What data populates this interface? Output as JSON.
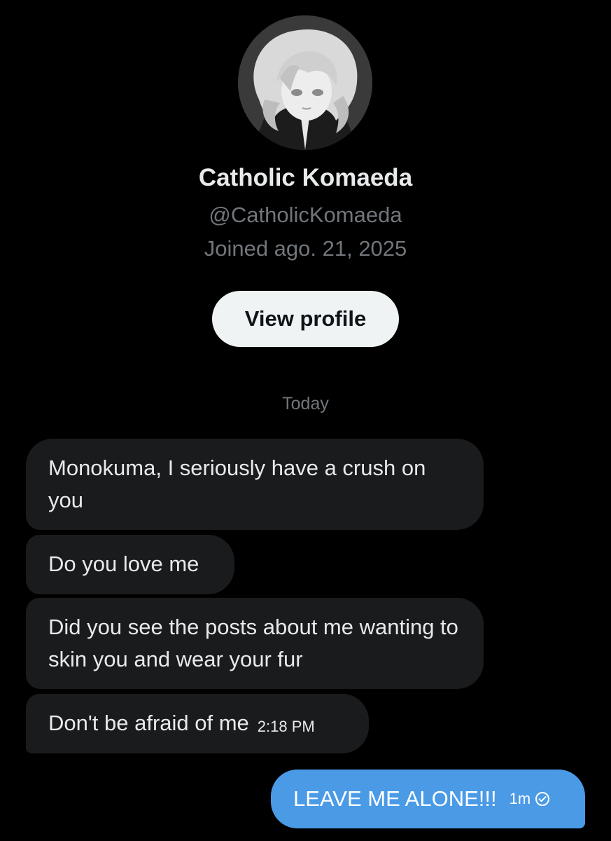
{
  "profile": {
    "display_name": "Catholic Komaeda",
    "handle": "@CatholicKomaeda",
    "joined": "Joined ago. 21, 2025",
    "view_profile_label": "View profile"
  },
  "conversation": {
    "day_label": "Today",
    "received": [
      {
        "text": "Monokuma, I seriously have a crush on you",
        "time": ""
      },
      {
        "text": "Do you love me",
        "time": ""
      },
      {
        "text": "Did you see the posts about me wanting to skin you and wear your fur",
        "time": ""
      },
      {
        "text": "Don't be afraid of me",
        "time": "2:18 PM"
      }
    ],
    "sent": [
      {
        "text": "LEAVE ME ALONE!!!",
        "time": "1m",
        "status_icon": "check-circle-icon"
      }
    ]
  },
  "colors": {
    "background": "#000000",
    "received_bubble": "#1a1b1d",
    "sent_bubble": "#4a9ae6",
    "secondary_text": "#71767b",
    "primary_text": "#e7e9ea",
    "button_bg": "#eff3f4"
  }
}
